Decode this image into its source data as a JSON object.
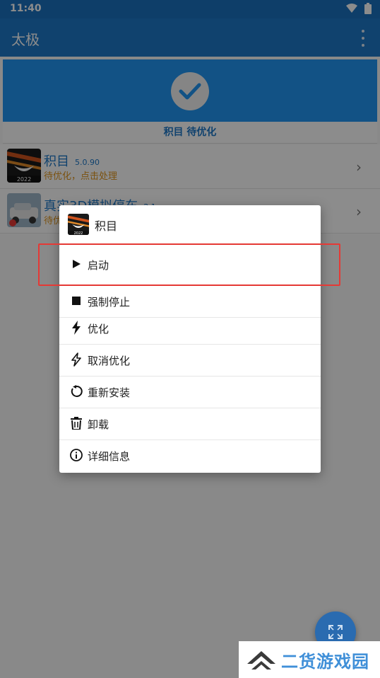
{
  "status_bar": {
    "time": "11:40"
  },
  "app_bar": {
    "title": "太极"
  },
  "banner": {
    "label": "积目 待优化"
  },
  "apps": [
    {
      "name": "积目",
      "version": "5.0.90",
      "status": "待优化，点击处理",
      "icon_badge": "2022"
    },
    {
      "name": "真实3D模拟停车",
      "version": "2.1",
      "status": "待优化，点击处理"
    }
  ],
  "dialog": {
    "title": "积目",
    "icon_badge": "2022",
    "items": [
      {
        "label": "启动",
        "icon": "play-icon"
      },
      {
        "label": "强制停止",
        "icon": "stop-icon"
      },
      {
        "label": "优化",
        "icon": "bolt-icon"
      },
      {
        "label": "取消优化",
        "icon": "bolt-off-icon"
      },
      {
        "label": "重新安装",
        "icon": "reinstall-icon"
      },
      {
        "label": "卸载",
        "icon": "trash-icon"
      },
      {
        "label": "详细信息",
        "icon": "info-icon"
      }
    ]
  },
  "watermark": {
    "text": "二货游戏园"
  },
  "colors": {
    "primary": "#1e78c8",
    "accent": "#2196f3",
    "warning": "#e0961e",
    "highlight": "#e53935"
  }
}
